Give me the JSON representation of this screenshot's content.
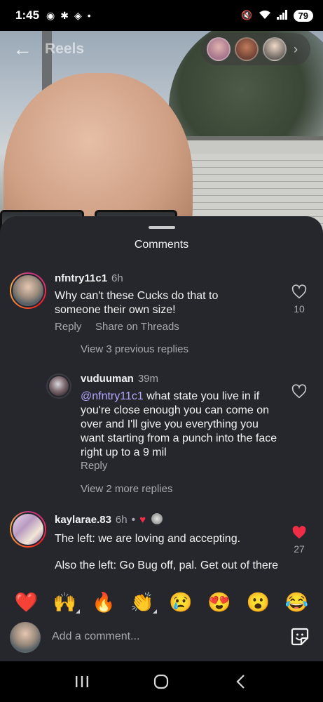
{
  "status_bar": {
    "time": "1:45",
    "left_icons": [
      "chrome-icon",
      "slack-icon",
      "app-icon",
      "dot"
    ],
    "right_icons": [
      "mute-icon",
      "wifi-icon",
      "signal-icon"
    ],
    "battery": "79"
  },
  "top_nav": {
    "title": "Reels"
  },
  "sheet": {
    "title": "Comments"
  },
  "comments": [
    {
      "username": "nfntry11c1",
      "time": "6h",
      "text": "Why can't these Cucks do that to someone their own size!",
      "reply_label": "Reply",
      "share_label": "Share on Threads",
      "likes": "10",
      "liked": false,
      "view_replies": "View 3 previous replies"
    },
    {
      "username": "vuduuman",
      "time": "39m",
      "mention": "@nfntry11c1",
      "text": "what state you live in if you're close enough you can come on over and I'll give you everything you want starting from a punch into the face right up to a 9 mil",
      "reply_label": "Reply",
      "liked": false,
      "view_more": "View 2 more replies"
    },
    {
      "username": "kaylarae.83",
      "time": "6h",
      "dot": "•",
      "text_line1": "The left: we are loving and accepting.",
      "text_line2": "Also the left: Go Bug off, pal. Get out of there",
      "likes": "27",
      "liked": true
    }
  ],
  "emoji_bar": [
    "❤️",
    "🙌",
    "🔥",
    "👏",
    "😢",
    "😍",
    "😮",
    "😂"
  ],
  "input": {
    "placeholder": "Add a comment..."
  },
  "colors": {
    "sheet_bg": "#26272d",
    "heart_red": "#ef2d47",
    "mention": "#b4a7ff",
    "muted": "#a8a8ad"
  }
}
